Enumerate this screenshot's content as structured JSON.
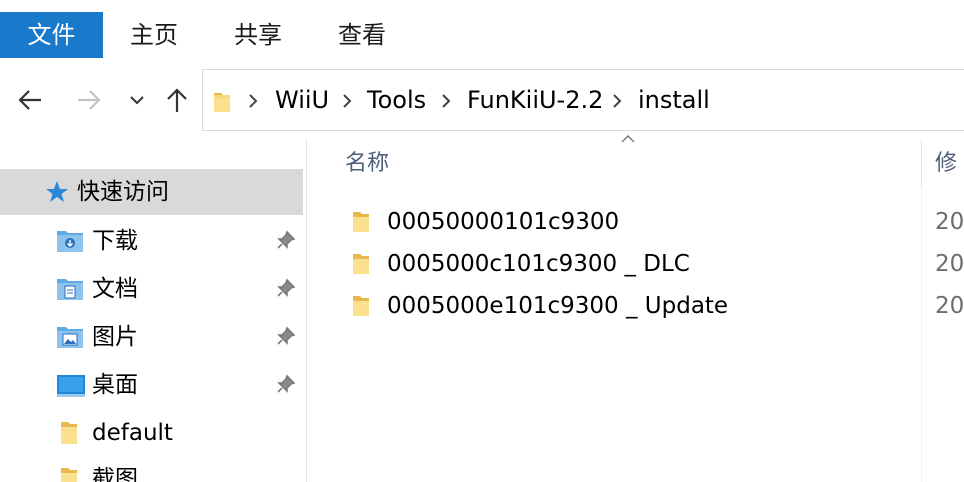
{
  "ribbon": {
    "tabs": [
      {
        "label": "文件",
        "active": true
      },
      {
        "label": "主页"
      },
      {
        "label": "共享"
      },
      {
        "label": "查看"
      }
    ]
  },
  "nav_buttons": {
    "back": "back-arrow-icon",
    "forward": "forward-arrow-icon",
    "recent": "chevron-down-icon",
    "up": "up-arrow-icon"
  },
  "breadcrumb": {
    "items": [
      "WiiU",
      "Tools",
      "FunKiiU-2.2",
      "install"
    ]
  },
  "nav_pane": {
    "quick_access": "快速访问",
    "items": [
      {
        "label": "下载",
        "icon": "downloads-folder-icon",
        "pinned": true
      },
      {
        "label": "文档",
        "icon": "documents-folder-icon",
        "pinned": true
      },
      {
        "label": "图片",
        "icon": "pictures-folder-icon",
        "pinned": true
      },
      {
        "label": "桌面",
        "icon": "desktop-folder-icon",
        "pinned": true
      },
      {
        "label": "default",
        "icon": "folder-icon",
        "pinned": false
      },
      {
        "label": "截图",
        "icon": "folder-icon",
        "pinned": false
      }
    ]
  },
  "columns": {
    "name": "名称",
    "modified": "修"
  },
  "files": [
    {
      "name": "00050000101c9300",
      "date": "20"
    },
    {
      "name": "0005000c101c9300 _ DLC",
      "date": "20"
    },
    {
      "name": "0005000e101c9300 _ Update",
      "date": "20"
    }
  ],
  "colors": {
    "accent": "#1979ca",
    "folder": "#f8d775",
    "selected_bg": "#d9d9d9"
  }
}
